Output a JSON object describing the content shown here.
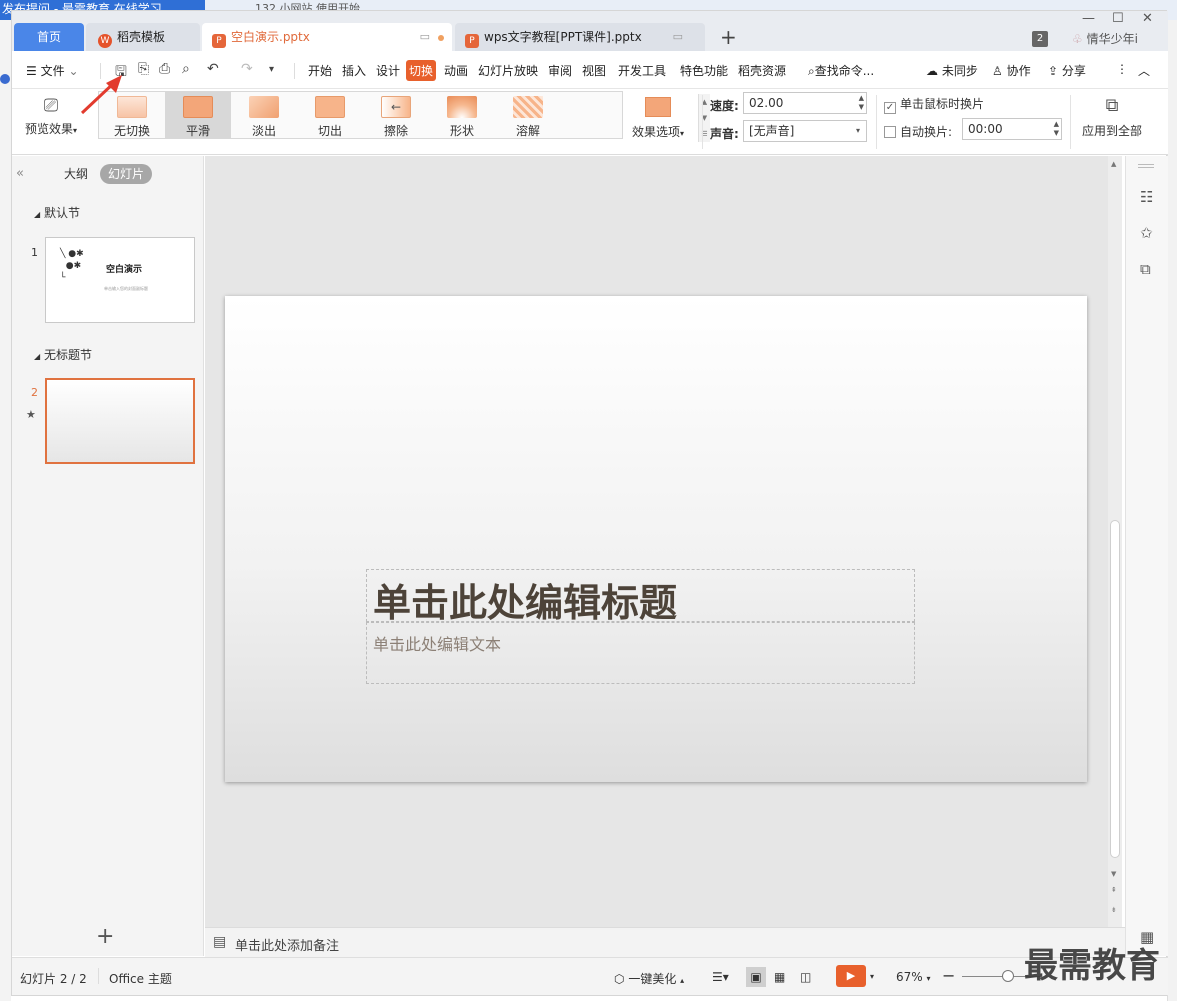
{
  "background": {
    "browser_tab_1": "发布提问 - 最需教育 在线学习",
    "browser_tab_2": "132 小网站 使用开始"
  },
  "tabs": {
    "home": "首页",
    "template": "稻壳模板",
    "doc1": "空白演示.pptx",
    "doc2": "wps文字教程[PPT课件].pptx",
    "add": "+"
  },
  "titlebar": {
    "badge": "2",
    "user": "情华少年i"
  },
  "menu": {
    "file": "文件",
    "items": [
      "开始",
      "插入",
      "设计",
      "切换",
      "动画",
      "幻灯片放映",
      "审阅",
      "视图",
      "开发工具",
      "特色功能",
      "稻壳资源"
    ],
    "active": "切换",
    "search": "查找命令...",
    "sync": "未同步",
    "collab": "协作",
    "share": "分享"
  },
  "ribbon": {
    "preview": "预览效果",
    "transitions": [
      "无切换",
      "平滑",
      "淡出",
      "切出",
      "擦除",
      "形状",
      "溶解"
    ],
    "selected_transition": "平滑",
    "effect_options": "效果选项",
    "speed_label": "速度:",
    "speed_value": "02.00",
    "sound_label": "声音:",
    "sound_value": "[无声音]",
    "on_click_label": "单击鼠标时换片",
    "on_click_checked": true,
    "auto_label": "自动换片:",
    "auto_checked": false,
    "auto_value": "00:00",
    "apply_all": "应用到全部"
  },
  "left_panel": {
    "tab_outline": "大纲",
    "tab_slides": "幻灯片",
    "section1": "默认节",
    "section2": "无标题节",
    "slide1_num": "1",
    "slide1_title": "空白演示",
    "slide1_sub": "单击输入您的封面副标题",
    "slide2_num": "2"
  },
  "slide": {
    "title_placeholder": "单击此处编辑标题",
    "subtitle_placeholder": "单击此处编辑文本"
  },
  "notes": {
    "placeholder": "单击此处添加备注"
  },
  "status": {
    "slide_counter": "幻灯片 2 / 2",
    "theme": "Office 主题",
    "beautify": "一键美化",
    "zoom": "67%"
  },
  "watermark": "最需教育",
  "colors": {
    "accent": "#e8602c",
    "home_tab": "#4a86e8"
  }
}
